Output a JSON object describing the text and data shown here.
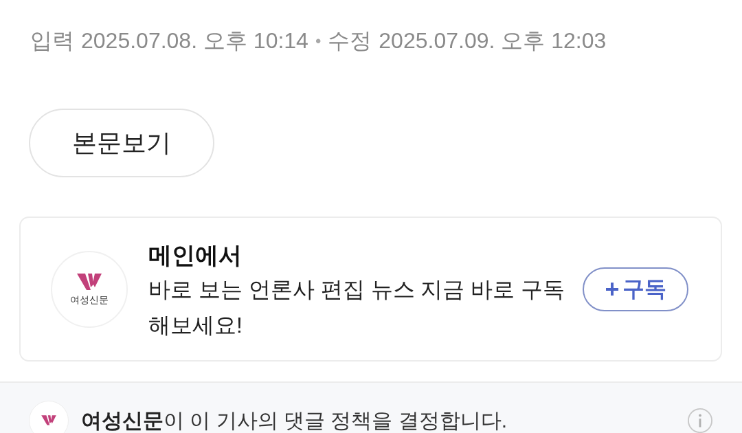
{
  "meta": {
    "input_label": "입력",
    "input_time": "2025.07.08. 오후 10:14",
    "separator": "•",
    "edit_label": "수정",
    "edit_time": "2025.07.09. 오후 12:03"
  },
  "view_button": "본문보기",
  "subscribe_card": {
    "logo_text": "여성신문",
    "title": "메인에서",
    "body": "바로 보는 언론사 편집 뉴스 지금 바로 구독해보세요!",
    "button_icon": "+",
    "button": "구독"
  },
  "comment_policy": {
    "text": "**여성신문**이 이 기사의 댓글 정책을 결정합니다."
  }
}
